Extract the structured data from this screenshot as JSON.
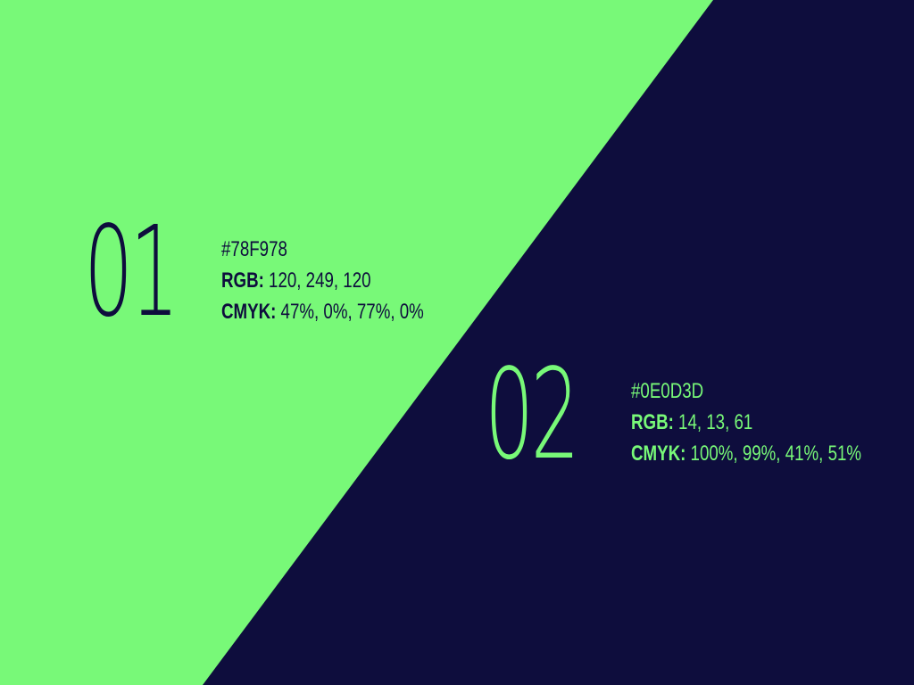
{
  "colors": {
    "primary": "#78F978",
    "secondary": "#0E0D3D"
  },
  "swatches": [
    {
      "number": "01",
      "hex": "#78F978",
      "rgb_label": "RGB:",
      "rgb_value": "120, 249, 120",
      "cmyk_label": "CMYK:",
      "cmyk_value": "47%, 0%, 77%, 0%"
    },
    {
      "number": "02",
      "hex": "#0E0D3D",
      "rgb_label": "RGB:",
      "rgb_value": "14, 13, 61",
      "cmyk_label": "CMYK:",
      "cmyk_value": "100%, 99%, 41%, 51%"
    }
  ]
}
